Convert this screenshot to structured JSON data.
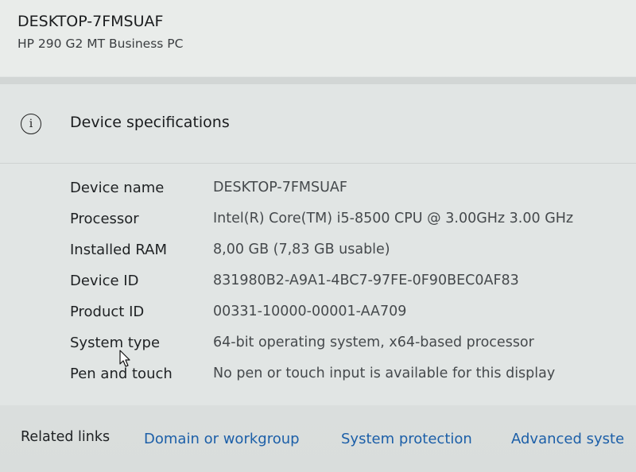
{
  "header": {
    "device_title": "DESKTOP-7FMSUAF",
    "device_model": "HP 290 G2 MT Business PC"
  },
  "specs": {
    "icon": "info-icon",
    "title": "Device specifications",
    "rows": [
      {
        "label": "Device name",
        "value": "DESKTOP-7FMSUAF"
      },
      {
        "label": "Processor",
        "value": "Intel(R) Core(TM) i5-8500 CPU @ 3.00GHz   3.00 GHz"
      },
      {
        "label": "Installed RAM",
        "value": "8,00 GB (7,83 GB usable)"
      },
      {
        "label": "Device ID",
        "value": "831980B2-A9A1-4BC7-97FE-0F90BEC0AF83"
      },
      {
        "label": "Product ID",
        "value": "00331-10000-00001-AA709"
      },
      {
        "label": "System type",
        "value": "64-bit operating system, x64-based processor"
      },
      {
        "label": "Pen and touch",
        "value": "No pen or touch input is available for this display"
      }
    ]
  },
  "related": {
    "label": "Related links",
    "links": [
      "Domain or workgroup",
      "System protection",
      "Advanced syste"
    ]
  },
  "colors": {
    "link": "#1c5fa8",
    "background": "#e1e5e4"
  }
}
